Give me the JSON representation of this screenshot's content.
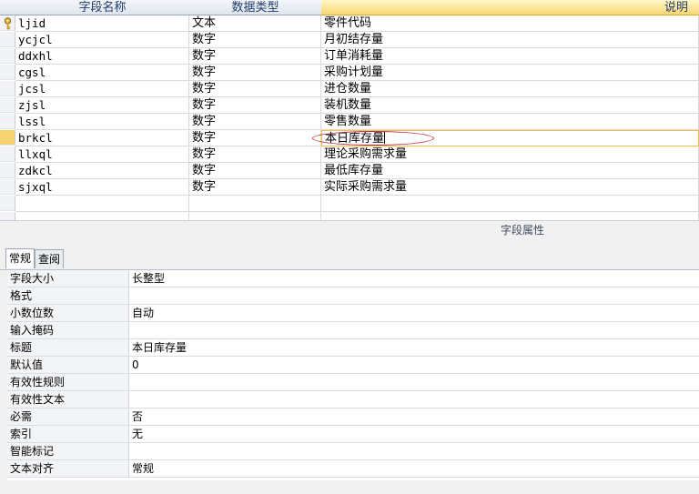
{
  "grid": {
    "headers": [
      "字段名称",
      "数据类型",
      "说明"
    ],
    "rows": [
      {
        "name": "ljid",
        "type": "文本",
        "desc": "零件代码"
      },
      {
        "name": "ycjcl",
        "type": "数字",
        "desc": "月初结存量"
      },
      {
        "name": "ddxhl",
        "type": "数字",
        "desc": "订单消耗量"
      },
      {
        "name": "cgsl",
        "type": "数字",
        "desc": "采购计划量"
      },
      {
        "name": "jcsl",
        "type": "数字",
        "desc": "进仓数量"
      },
      {
        "name": "zjsl",
        "type": "数字",
        "desc": "装机数量"
      },
      {
        "name": "lssl",
        "type": "数字",
        "desc": "零售数量"
      },
      {
        "name": "brkcl",
        "type": "数字",
        "desc": "本日库存量"
      },
      {
        "name": "llxql",
        "type": "数字",
        "desc": "理论采购需求量"
      },
      {
        "name": "zdkcl",
        "type": "数字",
        "desc": "最低库存量"
      },
      {
        "name": "sjxql",
        "type": "数字",
        "desc": "实际采购需求量"
      }
    ],
    "primary_key_icon": "key-icon"
  },
  "properties": {
    "title": "字段属性",
    "tabs": [
      "常规",
      "查阅"
    ],
    "rows": [
      {
        "label": "字段大小",
        "value": "长整型"
      },
      {
        "label": "格式",
        "value": ""
      },
      {
        "label": "小数位数",
        "value": "自动"
      },
      {
        "label": "输入掩码",
        "value": ""
      },
      {
        "label": "标题",
        "value": "本日库存量"
      },
      {
        "label": "默认值",
        "value": "0"
      },
      {
        "label": "有效性规则",
        "value": ""
      },
      {
        "label": "有效性文本",
        "value": ""
      },
      {
        "label": "必需",
        "value": "否"
      },
      {
        "label": "索引",
        "value": "无"
      },
      {
        "label": "智能标记",
        "value": ""
      },
      {
        "label": "文本对齐",
        "value": "常规"
      }
    ]
  },
  "colors": {
    "accent": "#f6d36f",
    "annotation": "#c0282d"
  }
}
